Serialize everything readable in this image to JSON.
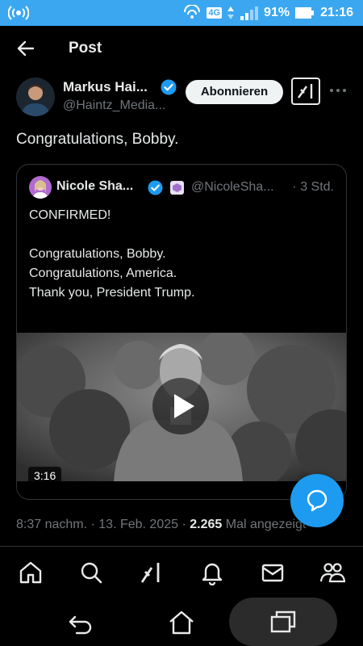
{
  "status_bar": {
    "network": "4G",
    "battery": "91%",
    "time": "21:16",
    "icons": [
      "hotspot-icon",
      "signal-icon",
      "battery-icon"
    ]
  },
  "header": {
    "title": "Post"
  },
  "post": {
    "author_name": "Markus Hai...",
    "author_handle": "@Haintz_Media...",
    "follow_label": "Abonnieren",
    "text": "Congratulations, Bobby.",
    "timestamp": "8:37 nachm. · 13. Feb. 2025 ·",
    "views_count": "2.265",
    "views_label": "Mal angezeigt"
  },
  "quoted_post": {
    "author_name": "Nicole Sha...",
    "author_handle": "@NicoleSha...",
    "time": "· 3 Std.",
    "lines": [
      "CONFIRMED!",
      "",
      "Congratulations, Bobby.",
      "Congratulations, America.",
      "Thank you, President Trump."
    ],
    "video_duration": "3:16"
  },
  "bottom_nav": [
    "home-icon",
    "search-icon",
    "grok-icon",
    "notifications-icon",
    "messages-icon",
    "communities-icon"
  ],
  "colors": {
    "accent": "#1d9bf0",
    "status_bar": "#3ba7f0",
    "background": "#000000",
    "text_primary": "#e7e9ea",
    "text_secondary": "#71767b"
  }
}
